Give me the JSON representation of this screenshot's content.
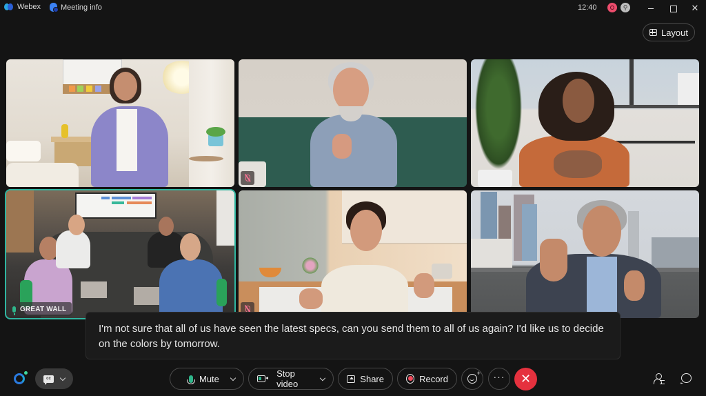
{
  "titlebar": {
    "app_name": "Webex",
    "meeting_info_label": "Meeting info",
    "time": "12:40",
    "window_controls": {
      "minimize": "minimize-icon",
      "maximize": "maximize-icon",
      "close": "✕"
    }
  },
  "layout_button": {
    "label": "Layout",
    "icon": "grid-icon"
  },
  "tiles": [
    {
      "id": "tile-1",
      "muted": false,
      "active": false
    },
    {
      "id": "tile-2",
      "muted": true,
      "active": false
    },
    {
      "id": "tile-3",
      "muted": false,
      "active": false
    },
    {
      "id": "tile-4",
      "name": "GREAT WALL",
      "muted": false,
      "active": true
    },
    {
      "id": "tile-5",
      "muted": true,
      "active": false
    },
    {
      "id": "tile-6",
      "muted": false,
      "active": false
    }
  ],
  "caption": {
    "text": "I'm not sure that all of us have seen the latest specs, can you send them to all of us again? I'd like us to decide on the colors by tomorrow."
  },
  "controls": {
    "ai_assistant_icon": "ai-assistant-icon",
    "captions_icon_text": "cc",
    "mute_label": "Mute",
    "stop_video_label": "Stop video",
    "share_label": "Share",
    "record_label": "Record",
    "more_label": "···",
    "end_label": "✕"
  },
  "colors": {
    "accent_active_speaker": "#2fb5a0",
    "end_call": "#e5313e",
    "mic_on": "#2fb58a",
    "mic_muted": "#f07090",
    "record": "#f0485a"
  }
}
